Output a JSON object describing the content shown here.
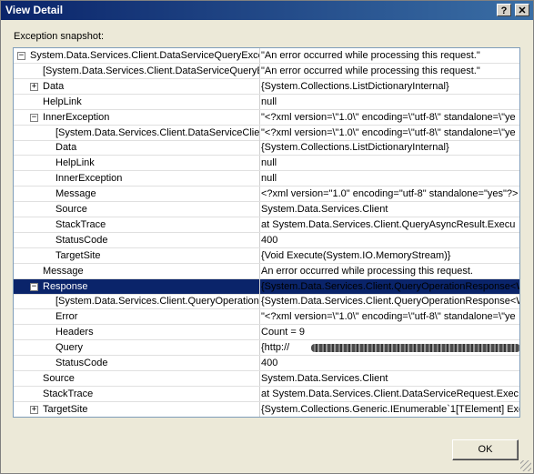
{
  "window": {
    "title": "View Detail",
    "help_glyph": "?",
    "close_glyph": "✕"
  },
  "section_label": "Exception snapshot:",
  "rows": [
    {
      "name": "System.Data.Services.Client.DataServiceQueryExce",
      "value": "\"An error occurred while processing this request.\"",
      "expander": "−"
    },
    {
      "name": "[System.Data.Services.Client.DataServiceQueryE",
      "value": "\"An error occurred while processing this request.\"",
      "expander": ""
    },
    {
      "name": "Data",
      "value": "{System.Collections.ListDictionaryInternal}",
      "expander": "+"
    },
    {
      "name": "HelpLink",
      "value": "null",
      "expander": ""
    },
    {
      "name": "InnerException",
      "value": "\"<?xml version=\\\"1.0\\\" encoding=\\\"utf-8\\\" standalone=\\\"ye",
      "expander": "−"
    },
    {
      "name": "[System.Data.Services.Client.DataServiceClie",
      "value": "\"<?xml version=\\\"1.0\\\" encoding=\\\"utf-8\\\" standalone=\\\"ye",
      "expander": ""
    },
    {
      "name": "Data",
      "value": "{System.Collections.ListDictionaryInternal}",
      "expander": ""
    },
    {
      "name": "HelpLink",
      "value": "null",
      "expander": ""
    },
    {
      "name": "InnerException",
      "value": "null",
      "expander": ""
    },
    {
      "name": "Message",
      "value": "<?xml version=\"1.0\" encoding=\"utf-8\" standalone=\"yes\"?>",
      "expander": ""
    },
    {
      "name": "Source",
      "value": "System.Data.Services.Client",
      "expander": ""
    },
    {
      "name": "StackTrace",
      "value": "   at System.Data.Services.Client.QueryAsyncResult.Execu",
      "expander": ""
    },
    {
      "name": "StatusCode",
      "value": "400",
      "expander": ""
    },
    {
      "name": "TargetSite",
      "value": "{Void Execute(System.IO.MemoryStream)}",
      "expander": ""
    },
    {
      "name": "Message",
      "value": "An error occurred while processing this request.",
      "expander": ""
    },
    {
      "name": "Response",
      "value": "{System.Data.Services.Client.QueryOperationResponse<W",
      "expander": "−",
      "selected": true
    },
    {
      "name": "[System.Data.Services.Client.QueryOperation",
      "value": "{System.Data.Services.Client.QueryOperationResponse<W",
      "expander": ""
    },
    {
      "name": "Error",
      "value": "\"<?xml version=\\\"1.0\\\" encoding=\\\"utf-8\\\" standalone=\\\"ye",
      "expander": ""
    },
    {
      "name": "Headers",
      "value": "Count = 9",
      "expander": ""
    },
    {
      "name": "Query",
      "value": "{http://",
      "expander": "",
      "redacted": true
    },
    {
      "name": "StatusCode",
      "value": "400",
      "expander": ""
    },
    {
      "name": "Source",
      "value": "System.Data.Services.Client",
      "expander": ""
    },
    {
      "name": "StackTrace",
      "value": "   at System.Data.Services.Client.DataServiceRequest.Exec",
      "expander": ""
    },
    {
      "name": "TargetSite",
      "value": "{System.Collections.Generic.IEnumerable`1[TElement] Exe",
      "expander": "+"
    }
  ],
  "ok_label": "OK",
  "colors": {
    "selection": "#0a246a",
    "title_start": "#0a246a",
    "title_end": "#3a6ea5",
    "face": "#ece9d8"
  }
}
